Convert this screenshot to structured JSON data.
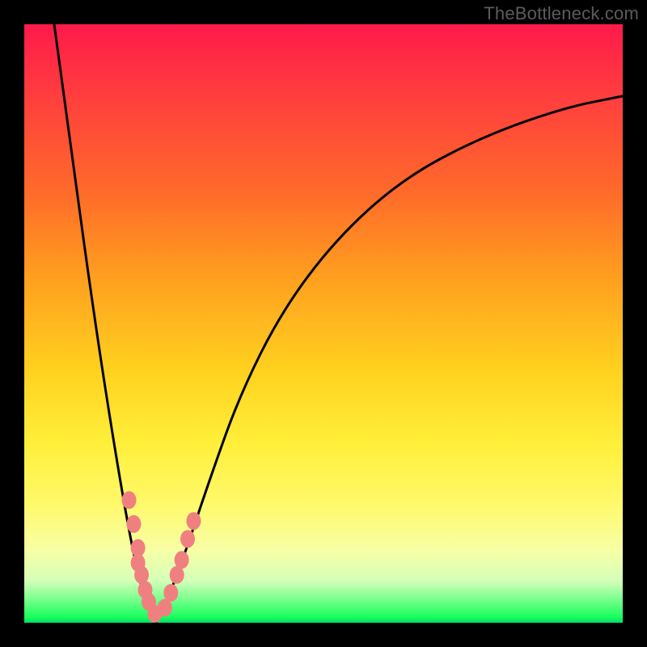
{
  "watermark": "TheBottleneck.com",
  "colors": {
    "frame": "#000000",
    "gradient_top": "#ff1a4b",
    "gradient_mid": "#ffd21f",
    "gradient_bottom": "#00e060",
    "curve": "#000000",
    "marker_fill": "#f08080",
    "marker_stroke": "#c05050"
  },
  "chart_data": {
    "type": "line",
    "title": "",
    "xlabel": "",
    "ylabel": "",
    "xlim": [
      0,
      100
    ],
    "ylim": [
      0,
      100
    ],
    "note": "V-shaped bottleneck curve on red-to-green gradient; minimum near x≈22, y≈0. Values read from pixel positions (no axis ticks present).",
    "series": [
      {
        "name": "bottleneck-curve-left",
        "x": [
          5,
          8,
          11,
          14,
          17,
          19,
          20.5,
          22
        ],
        "y": [
          100,
          78,
          56,
          36,
          18,
          8,
          3,
          0
        ]
      },
      {
        "name": "bottleneck-curve-right",
        "x": [
          22,
          24,
          27,
          31,
          36,
          43,
          52,
          63,
          76,
          90,
          100
        ],
        "y": [
          0,
          4,
          12,
          24,
          38,
          52,
          64,
          74,
          81,
          86,
          88
        ]
      }
    ],
    "markers": [
      {
        "x": 17.5,
        "y": 20.5
      },
      {
        "x": 18.3,
        "y": 16.5
      },
      {
        "x": 19.0,
        "y": 12.5
      },
      {
        "x": 19.0,
        "y": 10.0
      },
      {
        "x": 19.6,
        "y": 8.0
      },
      {
        "x": 20.2,
        "y": 5.5
      },
      {
        "x": 20.8,
        "y": 3.5
      },
      {
        "x": 21.8,
        "y": 1.5
      },
      {
        "x": 23.5,
        "y": 2.5
      },
      {
        "x": 24.5,
        "y": 5.0
      },
      {
        "x": 25.5,
        "y": 8.0
      },
      {
        "x": 26.3,
        "y": 10.5
      },
      {
        "x": 27.3,
        "y": 14.0
      },
      {
        "x": 28.3,
        "y": 17.0
      }
    ]
  }
}
